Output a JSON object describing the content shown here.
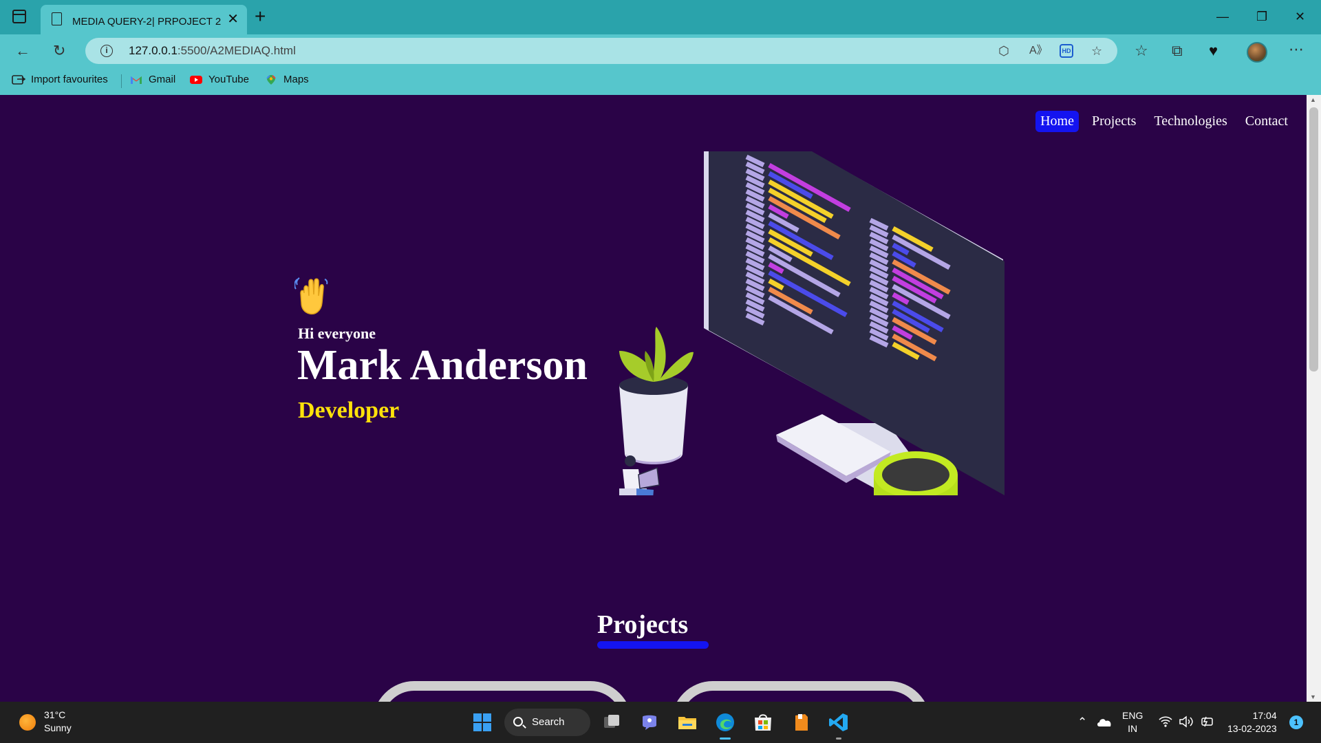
{
  "browser": {
    "tab_title": "MEDIA QUERY-2| PRPOJECT 2",
    "url_host": "127.0.0.1",
    "url_rest": ":5500/A2MEDIAQ.html",
    "bookmarks": [
      {
        "label": "Import favourites",
        "icon": "import-favourites-icon"
      },
      {
        "label": "Gmail",
        "icon": "gmail-icon"
      },
      {
        "label": "YouTube",
        "icon": "youtube-icon"
      },
      {
        "label": "Maps",
        "icon": "maps-icon"
      }
    ]
  },
  "site": {
    "nav": [
      "Home",
      "Projects",
      "Technologies",
      "Contact"
    ],
    "active_nav": "Home",
    "greeting": "Hi everyone",
    "name": "Mark Anderson",
    "role": "Developer",
    "projects_heading": "Projects"
  },
  "taskbar": {
    "temperature": "31°C",
    "condition": "Sunny",
    "search_label": "Search",
    "lang_line1": "ENG",
    "lang_line2": "IN",
    "time": "17:04",
    "date": "13-02-2023",
    "notifications": "1"
  },
  "colors": {
    "page_bg": "#2a0347",
    "nav_active": "#1414f0",
    "role_text": "#ffe20a",
    "browser_frame": "#56c6cc"
  }
}
